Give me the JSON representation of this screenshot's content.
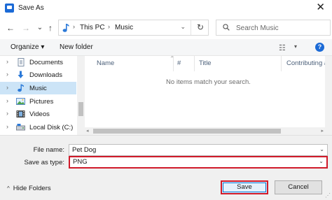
{
  "window": {
    "title": "Save As",
    "close_glyph": "✕"
  },
  "nav": {
    "back_glyph": "←",
    "forward_glyph": "→",
    "recent_glyph": "⌄",
    "up_glyph": "↑",
    "breadcrumb": [
      "This PC",
      "Music"
    ],
    "separator_glyph": "›",
    "dropdown_glyph": "⌄",
    "refresh_glyph": "↻"
  },
  "search": {
    "placeholder": "Search Music"
  },
  "commands": {
    "organize": "Organize ▾",
    "new_folder": "New folder",
    "view_glyph": "☷",
    "view_drop": "▾",
    "help": "?"
  },
  "sidebar": {
    "items": [
      {
        "label": "Documents",
        "icon": "documents-icon",
        "selected": false
      },
      {
        "label": "Downloads",
        "icon": "downloads-icon",
        "selected": false
      },
      {
        "label": "Music",
        "icon": "music-icon",
        "selected": true
      },
      {
        "label": "Pictures",
        "icon": "pictures-icon",
        "selected": false
      },
      {
        "label": "Videos",
        "icon": "videos-icon",
        "selected": false
      },
      {
        "label": "Local Disk (C:)",
        "icon": "local-disk-icon",
        "selected": false
      }
    ],
    "chevron_glyph": "›"
  },
  "filelist": {
    "columns": [
      "Name",
      "#",
      "Title",
      "Contributing art"
    ],
    "sort_glyph": "^",
    "empty_message": "No items match your search."
  },
  "form": {
    "file_name_label": "File name:",
    "file_name_value": "Pet Dog",
    "type_label": "Save as type:",
    "type_value": "PNG",
    "dropdown_glyph": "⌄"
  },
  "footer": {
    "hide_folders": "Hide Folders",
    "hide_chevron": "^",
    "save": "Save",
    "cancel": "Cancel"
  },
  "colors": {
    "accent": "#1b6ad6",
    "selection": "#cce4f7",
    "highlight_border": "#d01a2a",
    "header_text": "#4c607a"
  }
}
